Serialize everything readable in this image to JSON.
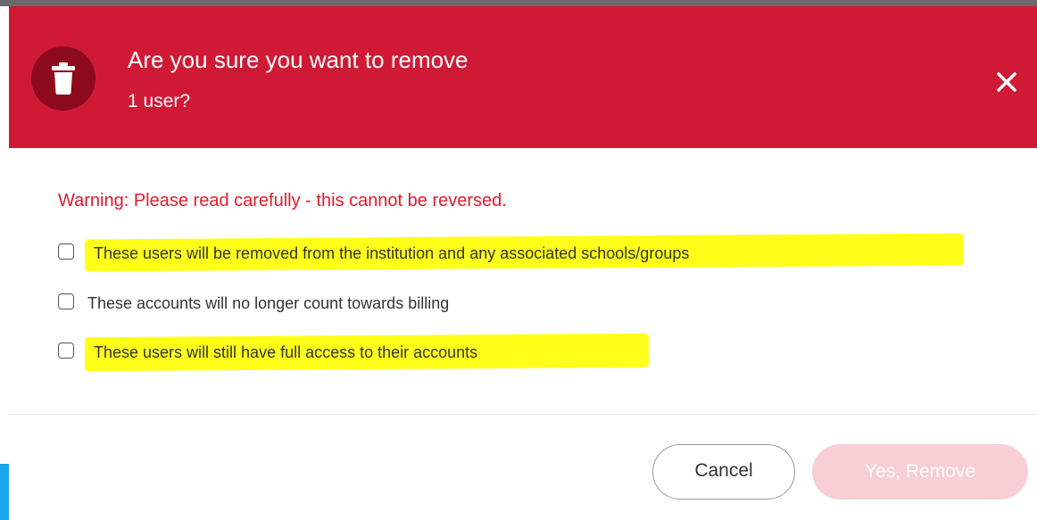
{
  "dialog": {
    "title": "Are you sure you want to remove",
    "subtitle": "1 user?",
    "icon": "trash-icon",
    "close_icon": "close-icon",
    "header_color": "#d01a35"
  },
  "warning": "Warning: Please read carefully - this cannot be reversed.",
  "checklist": [
    {
      "label": "These users will be removed from the institution and any associated schools/groups",
      "checked": false,
      "highlighted": true
    },
    {
      "label": "These accounts will no longer count towards billing",
      "checked": false,
      "highlighted": false
    },
    {
      "label": "These users will still have full access to their accounts",
      "checked": false,
      "highlighted": true
    }
  ],
  "buttons": {
    "cancel": "Cancel",
    "confirm": "Yes, Remove",
    "confirm_disabled": true
  },
  "colors": {
    "warning": "#e01a2e",
    "highlight": "#ffff1a",
    "confirm_disabled": "#f8cfd4"
  }
}
